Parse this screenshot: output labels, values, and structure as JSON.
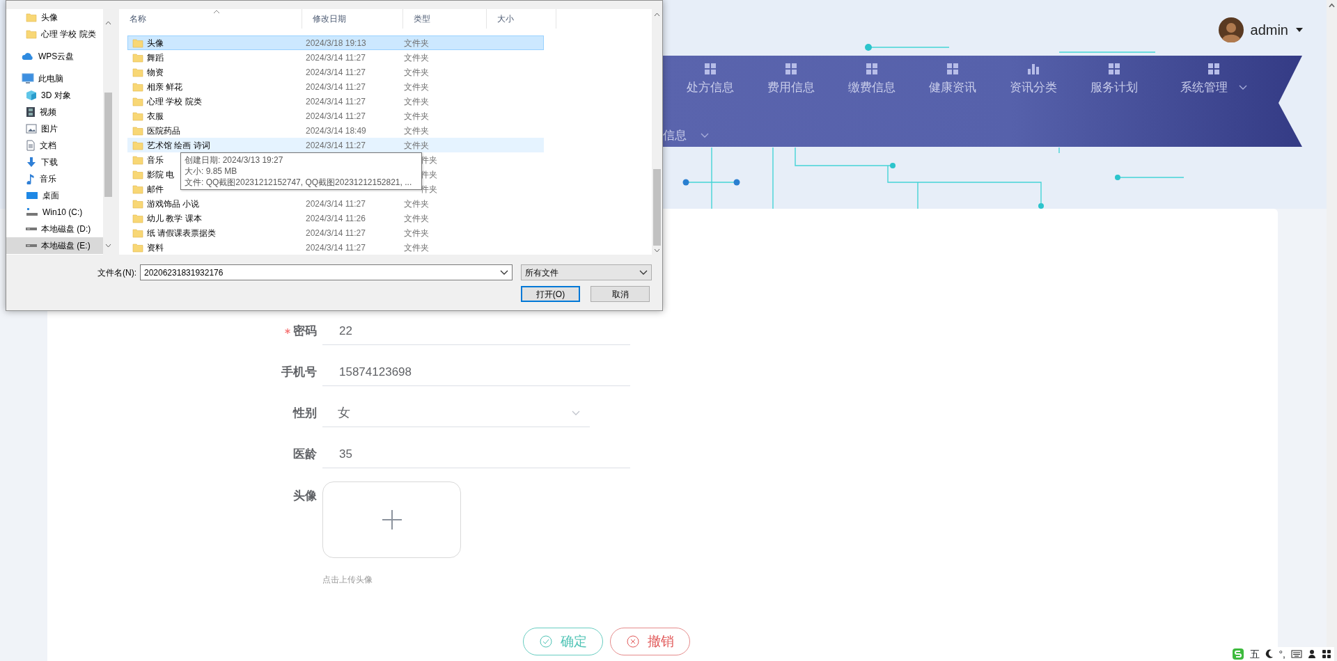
{
  "file_dialog": {
    "pinned": [
      {
        "label": "头像",
        "kind": "folder",
        "selected": false
      },
      {
        "label": "心理 学校 院类",
        "kind": "folder",
        "selected": false
      }
    ],
    "tree": [
      {
        "label": "WPS云盘",
        "kind": "cloud",
        "selected": false
      },
      {
        "label": "此电脑",
        "kind": "pc",
        "selected": false,
        "children": [
          {
            "label": "3D 对象",
            "kind": "cube",
            "selected": false
          },
          {
            "label": "视频",
            "kind": "film",
            "selected": false
          },
          {
            "label": "图片",
            "kind": "picture",
            "selected": false
          },
          {
            "label": "文档",
            "kind": "doc",
            "selected": false
          },
          {
            "label": "下载",
            "kind": "download",
            "selected": false
          },
          {
            "label": "音乐",
            "kind": "music",
            "selected": false
          },
          {
            "label": "桌面",
            "kind": "desktop",
            "selected": false
          },
          {
            "label": "Win10 (C:)",
            "kind": "system-drive",
            "selected": false
          },
          {
            "label": "本地磁盘 (D:)",
            "kind": "drive",
            "selected": false
          },
          {
            "label": "本地磁盘 (E:)",
            "kind": "drive",
            "selected": true
          }
        ]
      }
    ],
    "columns": [
      "名称",
      "修改日期",
      "类型",
      "大小"
    ],
    "rows": [
      {
        "name": "头像",
        "date": "2024/3/18 19:13",
        "type": "文件夹",
        "selected": true,
        "hovered": false
      },
      {
        "name": "舞蹈",
        "date": "2024/3/14 11:27",
        "type": "文件夹",
        "selected": false,
        "hovered": false
      },
      {
        "name": "物资",
        "date": "2024/3/14 11:27",
        "type": "文件夹",
        "selected": false,
        "hovered": false
      },
      {
        "name": "相亲 鲜花",
        "date": "2024/3/14 11:27",
        "type": "文件夹",
        "selected": false,
        "hovered": false
      },
      {
        "name": "心理 学校 院类",
        "date": "2024/3/14 11:27",
        "type": "文件夹",
        "selected": false,
        "hovered": false
      },
      {
        "name": "衣服",
        "date": "2024/3/14 11:27",
        "type": "文件夹",
        "selected": false,
        "hovered": false
      },
      {
        "name": "医院药品",
        "date": "2024/3/14 18:49",
        "type": "文件夹",
        "selected": false,
        "hovered": false
      },
      {
        "name": "艺术馆 绘画 诗词",
        "date": "2024/3/14 11:27",
        "type": "文件夹",
        "selected": false,
        "hovered": true
      },
      {
        "name": "音乐",
        "type": "件夹",
        "selected": false,
        "hovered": false
      },
      {
        "name": "影院 电",
        "type": "件夹",
        "selected": false,
        "hovered": false
      },
      {
        "name": "邮件",
        "type": "件夹",
        "selected": false,
        "hovered": false
      },
      {
        "name": "游戏饰品 小说",
        "date": "2024/3/14 11:27",
        "type": "文件夹",
        "selected": false,
        "hovered": false
      },
      {
        "name": "幼儿 教学 课本",
        "date": "2024/3/14 11:26",
        "type": "文件夹",
        "selected": false,
        "hovered": false
      },
      {
        "name": "纸 请假课表票据类",
        "date": "2024/3/14 11:27",
        "type": "文件夹",
        "selected": false,
        "hovered": false
      },
      {
        "name": "资料",
        "date": "2024/3/14 11:27",
        "type": "文件夹",
        "selected": false,
        "hovered": false
      }
    ],
    "tooltip": {
      "lines": [
        "创建日期: 2024/3/13 19:27",
        "大小: 9.85 MB",
        "文件: QQ截图20231212152747, QQ截图20231212152821, ..."
      ]
    },
    "file_name_label": "文件名(N):",
    "file_name": "20206231831932176",
    "file_type": "所有文件",
    "buttons": [
      {
        "label": "打开(O)",
        "default": true
      },
      {
        "label": "取消",
        "default": false
      }
    ]
  },
  "header": {
    "user": "admin",
    "nav": [
      {
        "label": "处方信息",
        "kind": "grid",
        "dropdown": false
      },
      {
        "label": "费用信息",
        "kind": "grid",
        "dropdown": false
      },
      {
        "label": "缴费信息",
        "kind": "grid",
        "dropdown": false
      },
      {
        "label": "健康资讯",
        "kind": "grid",
        "dropdown": false
      },
      {
        "label": "资讯分类",
        "kind": "chart",
        "dropdown": false
      },
      {
        "label": "服务计划",
        "kind": "grid",
        "dropdown": false
      },
      {
        "label": "系统管理",
        "kind": "grid",
        "dropdown": true
      }
    ],
    "nav_row2": [
      {
        "label": "信息",
        "dropdown": true
      }
    ]
  },
  "form": {
    "fields": [
      {
        "kind": "text",
        "label": "密码",
        "required": true,
        "value": "22"
      },
      {
        "kind": "text",
        "label": "手机号",
        "required": false,
        "value": "15874123698"
      },
      {
        "kind": "select",
        "label": "性别",
        "required": false,
        "value": "女"
      },
      {
        "kind": "text",
        "label": "医龄",
        "required": false,
        "value": "35"
      },
      {
        "kind": "upload",
        "label": "头像",
        "required": false,
        "hint": "点击上传头像"
      }
    ],
    "buttons": [
      {
        "kind": "confirm",
        "label": "确定"
      },
      {
        "kind": "cancel",
        "label": "撤销"
      }
    ]
  },
  "ime_bar": {
    "mode": "五",
    "punctuation": "°,"
  }
}
